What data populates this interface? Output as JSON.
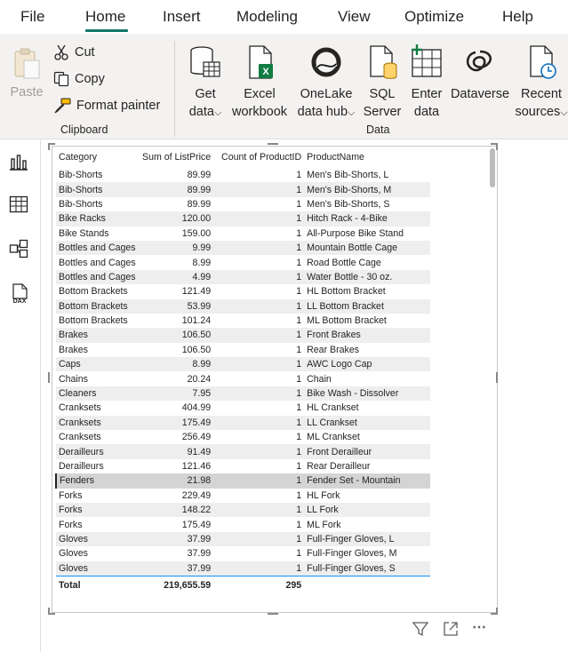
{
  "tabs": [
    {
      "label": "File"
    },
    {
      "label": "Home"
    },
    {
      "label": "Insert"
    },
    {
      "label": "Modeling"
    },
    {
      "label": "View"
    },
    {
      "label": "Optimize"
    },
    {
      "label": "Help"
    }
  ],
  "active_tab": "Home",
  "accent_color": "#117865",
  "clipboard": {
    "paste_label": "Paste",
    "cut_label": "Cut",
    "copy_label": "Copy",
    "format_painter_label": "Format painter",
    "group_label": "Clipboard"
  },
  "data_group": {
    "get_data": {
      "line1": "Get",
      "line2": "data"
    },
    "excel": {
      "line1": "Excel",
      "line2": "workbook"
    },
    "onelake": {
      "line1": "OneLake",
      "line2": "data hub"
    },
    "sql": {
      "line1": "SQL",
      "line2": "Server"
    },
    "enter": {
      "line1": "Enter",
      "line2": "data"
    },
    "dataverse": {
      "line1": "Dataverse"
    },
    "recent": {
      "line1": "Recent",
      "line2": "sources"
    },
    "group_label": "Data"
  },
  "rail_icons": [
    "report-view-icon",
    "table-view-icon",
    "model-view-icon",
    "dax-query-view-icon"
  ],
  "dax_label": "DAX",
  "table": {
    "headers": [
      "Category",
      "Sum of ListPrice",
      "Count of ProductID",
      "ProductName"
    ],
    "rows": [
      [
        "Bib-Shorts",
        "89.99",
        "1",
        "Men's Bib-Shorts, L"
      ],
      [
        "Bib-Shorts",
        "89.99",
        "1",
        "Men's Bib-Shorts, M"
      ],
      [
        "Bib-Shorts",
        "89.99",
        "1",
        "Men's Bib-Shorts, S"
      ],
      [
        "Bike Racks",
        "120.00",
        "1",
        "Hitch Rack - 4-Bike"
      ],
      [
        "Bike Stands",
        "159.00",
        "1",
        "All-Purpose Bike Stand"
      ],
      [
        "Bottles and Cages",
        "9.99",
        "1",
        "Mountain Bottle Cage"
      ],
      [
        "Bottles and Cages",
        "8.99",
        "1",
        "Road Bottle Cage"
      ],
      [
        "Bottles and Cages",
        "4.99",
        "1",
        "Water Bottle - 30 oz."
      ],
      [
        "Bottom Brackets",
        "121.49",
        "1",
        "HL Bottom Bracket"
      ],
      [
        "Bottom Brackets",
        "53.99",
        "1",
        "LL Bottom Bracket"
      ],
      [
        "Bottom Brackets",
        "101.24",
        "1",
        "ML Bottom Bracket"
      ],
      [
        "Brakes",
        "106.50",
        "1",
        "Front Brakes"
      ],
      [
        "Brakes",
        "106.50",
        "1",
        "Rear Brakes"
      ],
      [
        "Caps",
        "8.99",
        "1",
        "AWC Logo Cap"
      ],
      [
        "Chains",
        "20.24",
        "1",
        "Chain"
      ],
      [
        "Cleaners",
        "7.95",
        "1",
        "Bike Wash - Dissolver"
      ],
      [
        "Cranksets",
        "404.99",
        "1",
        "HL Crankset"
      ],
      [
        "Cranksets",
        "175.49",
        "1",
        "LL Crankset"
      ],
      [
        "Cranksets",
        "256.49",
        "1",
        "ML Crankset"
      ],
      [
        "Derailleurs",
        "91.49",
        "1",
        "Front Derailleur"
      ],
      [
        "Derailleurs",
        "121.46",
        "1",
        "Rear Derailleur"
      ],
      [
        "Fenders",
        "21.98",
        "1",
        "Fender Set - Mountain"
      ],
      [
        "Forks",
        "229.49",
        "1",
        "HL Fork"
      ],
      [
        "Forks",
        "148.22",
        "1",
        "LL Fork"
      ],
      [
        "Forks",
        "175.49",
        "1",
        "ML Fork"
      ],
      [
        "Gloves",
        "37.99",
        "1",
        "Full-Finger Gloves, L"
      ],
      [
        "Gloves",
        "37.99",
        "1",
        "Full-Finger Gloves, M"
      ],
      [
        "Gloves",
        "37.99",
        "1",
        "Full-Finger Gloves, S"
      ]
    ],
    "selected_row_index": 21,
    "total": [
      "Total",
      "219,655.59",
      "295",
      ""
    ]
  },
  "visual_footer_icons": [
    "filter-icon",
    "focus-mode-icon",
    "more-options-icon"
  ]
}
